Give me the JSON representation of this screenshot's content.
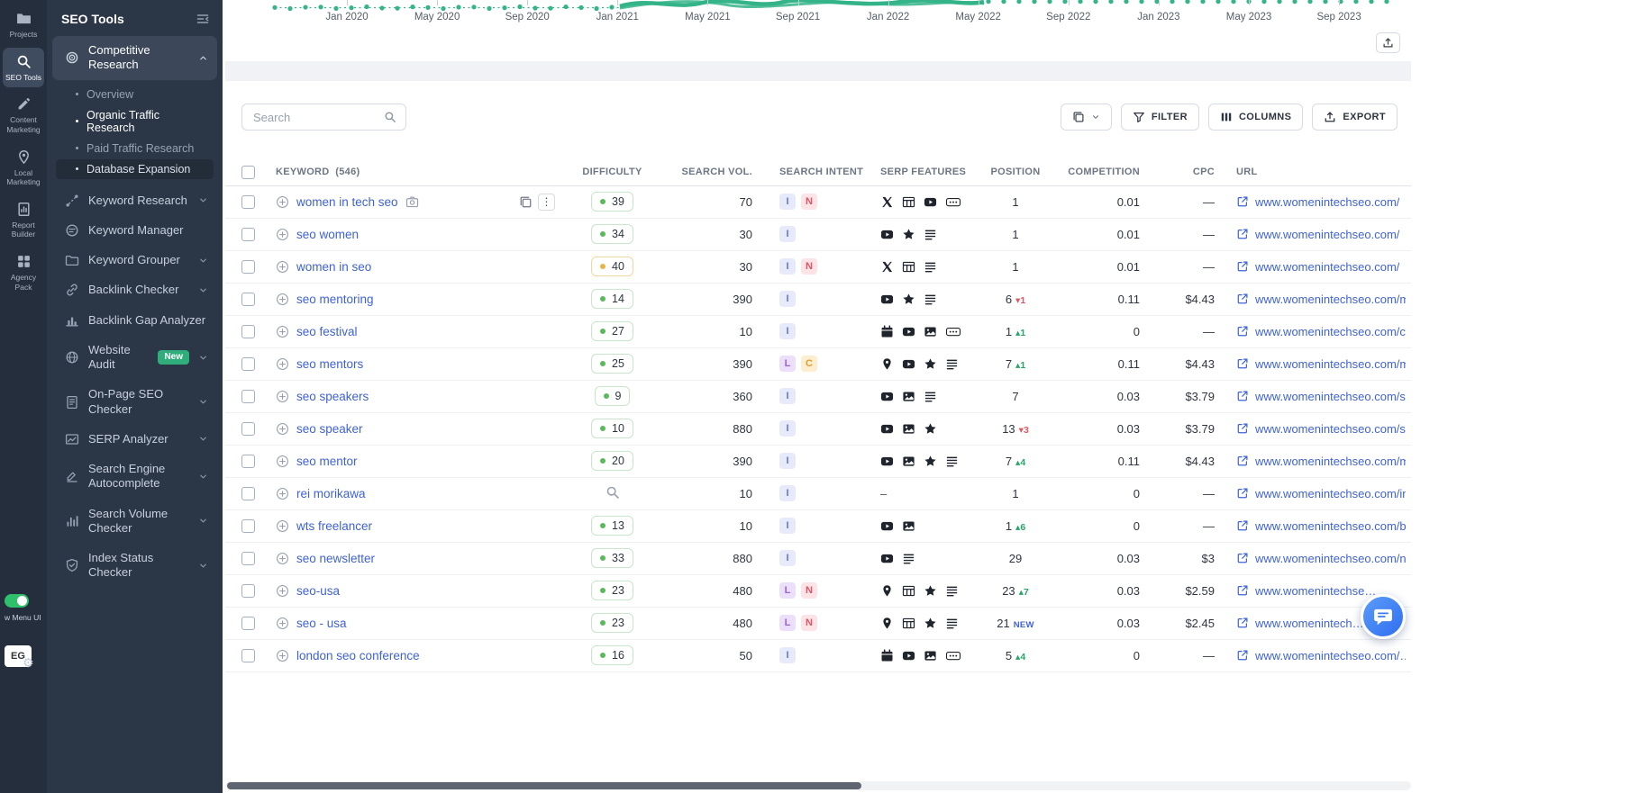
{
  "rail": {
    "items": [
      {
        "label": "Projects",
        "icon": "folder",
        "active": false
      },
      {
        "label": "SEO Tools",
        "icon": "search",
        "active": true
      },
      {
        "label": "Content Marketing",
        "icon": "edit",
        "active": false
      },
      {
        "label": "Local Marketing",
        "icon": "pin",
        "active": false
      },
      {
        "label": "Report Builder",
        "icon": "report",
        "active": false
      },
      {
        "label": "Agency Pack",
        "icon": "grid",
        "active": false
      }
    ],
    "menu_toggle_label": "w Menu UI",
    "avatar_initials": "EG"
  },
  "sidebar": {
    "title": "SEO Tools",
    "items": [
      {
        "label": "Competitive Research",
        "icon": "target",
        "expanded": true,
        "active": true,
        "children": [
          {
            "label": "Overview"
          },
          {
            "label": "Organic Traffic Research",
            "active": true
          },
          {
            "label": "Paid Traffic Research"
          },
          {
            "label": "Database Expansion",
            "selected": true
          }
        ]
      },
      {
        "label": "Keyword Research",
        "icon": "route",
        "chevron": true
      },
      {
        "label": "Keyword Manager",
        "icon": "manager"
      },
      {
        "label": "Keyword Grouper",
        "icon": "grouper",
        "chevron": true
      },
      {
        "label": "Backlink Checker",
        "icon": "link",
        "chevron": true
      },
      {
        "label": "Backlink Gap Analyzer",
        "icon": "gap"
      },
      {
        "label": "Website Audit",
        "icon": "globe",
        "badge": "New",
        "chevron": true
      },
      {
        "label": "On-Page SEO Checker",
        "icon": "page",
        "chevron": true
      },
      {
        "label": "SERP Analyzer",
        "icon": "serp",
        "chevron": true
      },
      {
        "label": "Search Engine Autocomplete",
        "icon": "autocomplete",
        "chevron": true
      },
      {
        "label": "Search Volume Checker",
        "icon": "volume",
        "chevron": true
      },
      {
        "label": "Index Status Checker",
        "icon": "shield",
        "chevron": true
      }
    ]
  },
  "chart": {
    "x_labels": [
      "Jan 2020",
      "May 2020",
      "Sep 2020",
      "Jan 2021",
      "May 2021",
      "Sep 2021",
      "Jan 2022",
      "May 2022",
      "Sep 2022",
      "Jan 2023",
      "May 2023",
      "Sep 2023"
    ],
    "series_color": "#34b488"
  },
  "toolbar": {
    "search_placeholder": "Search",
    "filter_label": "FILTER",
    "columns_label": "COLUMNS",
    "export_label": "EXPORT"
  },
  "table": {
    "keyword_header": "KEYWORD",
    "keyword_count": "(546)",
    "columns": [
      "DIFFICULTY",
      "SEARCH VOL.",
      "SEARCH INTENT",
      "SERP FEATURES",
      "POSITION",
      "COMPETITION",
      "CPC",
      "URL"
    ],
    "rows": [
      {
        "keyword": "women in tech seo",
        "camera": true,
        "actions": true,
        "difficulty": {
          "value": 39,
          "level": "green"
        },
        "volume": "70",
        "intents": [
          "I",
          "N"
        ],
        "serp": [
          "x",
          "table",
          "youtube",
          "more"
        ],
        "position": "1",
        "change": null,
        "competition": "0.01",
        "cpc": "—",
        "url": "www.womenintechseo.com/"
      },
      {
        "keyword": "seo women",
        "difficulty": {
          "value": 34,
          "level": "green"
        },
        "volume": "30",
        "intents": [
          "I"
        ],
        "serp": [
          "youtube",
          "star",
          "list"
        ],
        "position": "1",
        "change": null,
        "competition": "0.01",
        "cpc": "—",
        "url": "www.womenintechseo.com/"
      },
      {
        "keyword": "women in seo",
        "difficulty": {
          "value": 40,
          "level": "yellow"
        },
        "volume": "30",
        "intents": [
          "I",
          "N"
        ],
        "serp": [
          "x",
          "table",
          "list"
        ],
        "position": "1",
        "change": null,
        "competition": "0.01",
        "cpc": "—",
        "url": "www.womenintechseo.com/"
      },
      {
        "keyword": "seo mentoring",
        "difficulty": {
          "value": 14,
          "level": "green"
        },
        "volume": "390",
        "intents": [
          "I"
        ],
        "serp": [
          "youtube",
          "star",
          "list"
        ],
        "position": "6",
        "change": {
          "dir": "down",
          "value": "1"
        },
        "competition": "0.11",
        "cpc": "$4.43",
        "url": "www.womenintechseo.com/m…"
      },
      {
        "keyword": "seo festival",
        "difficulty": {
          "value": 27,
          "level": "green"
        },
        "volume": "10",
        "intents": [
          "I"
        ],
        "serp": [
          "calendar",
          "youtube",
          "image",
          "more"
        ],
        "position": "1",
        "change": {
          "dir": "up",
          "value": "1"
        },
        "competition": "0",
        "cpc": "—",
        "url": "www.womenintechseo.com/c…"
      },
      {
        "keyword": "seo mentors",
        "difficulty": {
          "value": 25,
          "level": "green"
        },
        "volume": "390",
        "intents": [
          "L",
          "C"
        ],
        "serp": [
          "pin",
          "youtube",
          "star",
          "list"
        ],
        "position": "7",
        "change": {
          "dir": "up",
          "value": "1"
        },
        "competition": "0.11",
        "cpc": "$4.43",
        "url": "www.womenintechseo.com/m…"
      },
      {
        "keyword": "seo speakers",
        "difficulty": {
          "value": 9,
          "level": "green"
        },
        "volume": "360",
        "intents": [
          "I"
        ],
        "serp": [
          "youtube",
          "image",
          "list"
        ],
        "position": "7",
        "change": null,
        "competition": "0.03",
        "cpc": "$3.79",
        "url": "www.womenintechseo.com/sp…"
      },
      {
        "keyword": "seo speaker",
        "difficulty": {
          "value": 10,
          "level": "green"
        },
        "volume": "880",
        "intents": [
          "I"
        ],
        "serp": [
          "youtube",
          "image",
          "star"
        ],
        "position": "13",
        "change": {
          "dir": "down",
          "value": "3"
        },
        "competition": "0.03",
        "cpc": "$3.79",
        "url": "www.womenintechseo.com/sp…"
      },
      {
        "keyword": "seo mentor",
        "difficulty": {
          "value": 20,
          "level": "green"
        },
        "volume": "390",
        "intents": [
          "I"
        ],
        "serp": [
          "youtube",
          "image",
          "star",
          "list"
        ],
        "position": "7",
        "change": {
          "dir": "up",
          "value": "4"
        },
        "competition": "0.11",
        "cpc": "$4.43",
        "url": "www.womenintechseo.com/m…"
      },
      {
        "keyword": "rei morikawa",
        "difficulty": null,
        "volume": "10",
        "intents": [
          "I"
        ],
        "serp": [],
        "serp_empty": "–",
        "position": "1",
        "change": null,
        "competition": "0",
        "cpc": "—",
        "url": "www.womenintechseo.com/in…"
      },
      {
        "keyword": "wts freelancer",
        "difficulty": {
          "value": 13,
          "level": "green"
        },
        "volume": "10",
        "intents": [
          "I"
        ],
        "serp": [
          "youtube",
          "image"
        ],
        "position": "1",
        "change": {
          "dir": "up",
          "value": "6"
        },
        "competition": "0",
        "cpc": "—",
        "url": "www.womenintechseo.com/b…"
      },
      {
        "keyword": "seo newsletter",
        "difficulty": {
          "value": 33,
          "level": "green"
        },
        "volume": "880",
        "intents": [
          "I"
        ],
        "serp": [
          "youtube",
          "list"
        ],
        "position": "29",
        "change": null,
        "competition": "0.03",
        "cpc": "$3",
        "url": "www.womenintechseo.com/n…"
      },
      {
        "keyword": "seo-usa",
        "difficulty": {
          "value": 23,
          "level": "green"
        },
        "volume": "480",
        "intents": [
          "L",
          "N"
        ],
        "serp": [
          "pin",
          "table",
          "star",
          "list"
        ],
        "position": "23",
        "change": {
          "dir": "up",
          "value": "7"
        },
        "competition": "0.03",
        "cpc": "$2.59",
        "url": "www.womenintechse…"
      },
      {
        "keyword": "seo - usa",
        "difficulty": {
          "value": 23,
          "level": "green"
        },
        "volume": "480",
        "intents": [
          "L",
          "N"
        ],
        "serp": [
          "pin",
          "table",
          "star",
          "list"
        ],
        "position": "21",
        "change": {
          "dir": "new"
        },
        "competition": "0.03",
        "cpc": "$2.45",
        "url": "www.womenintech…"
      },
      {
        "keyword": "london seo conference",
        "difficulty": {
          "value": 16,
          "level": "green"
        },
        "volume": "50",
        "intents": [
          "I"
        ],
        "serp": [
          "calendar",
          "youtube",
          "image",
          "more"
        ],
        "position": "5",
        "change": {
          "dir": "up",
          "value": "4"
        },
        "competition": "0",
        "cpc": "—",
        "url": "www.womenintechseo.com/…"
      }
    ]
  }
}
